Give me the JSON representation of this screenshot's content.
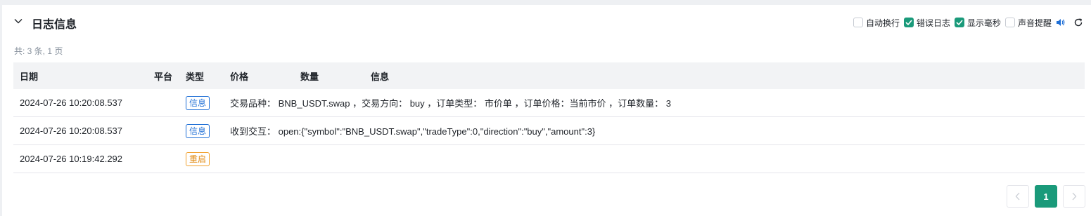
{
  "panel": {
    "title": "日志信息",
    "summary": "共: 3 条, 1 页"
  },
  "options": [
    {
      "label": "自动换行",
      "checked": false
    },
    {
      "label": "错误日志",
      "checked": true
    },
    {
      "label": "显示毫秒",
      "checked": true
    },
    {
      "label": "声音提醒",
      "checked": false
    }
  ],
  "table": {
    "headers": {
      "date": "日期",
      "platform": "平台",
      "type": "类型",
      "price": "价格",
      "quantity": "数量",
      "info": "信息"
    },
    "rows": [
      {
        "date": "2024-07-26 10:20:08.537",
        "platform": "",
        "type": "信息",
        "info": "交易品种： BNB_USDT.swap ，交易方向： buy ，订单类型： 市价单 ，订单价格：当前市价 ，订单数量： 3"
      },
      {
        "date": "2024-07-26 10:20:08.537",
        "platform": "",
        "type": "信息",
        "info": "收到交互： open:{\"symbol\":\"BNB_USDT.swap\",\"tradeType\":0,\"direction\":\"buy\",\"amount\":3}"
      },
      {
        "date": "2024-07-26 10:19:42.292",
        "platform": "",
        "type": "重启",
        "info": ""
      }
    ]
  },
  "pagination": {
    "current_page": "1"
  },
  "colors": {
    "accent": "#1a9a7a",
    "info_tag": "#1f6fd6",
    "restart_tag": "#e08a12"
  }
}
